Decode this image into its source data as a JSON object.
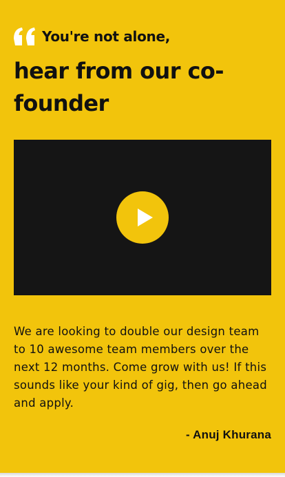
{
  "testimonial": {
    "subtitle": "You're not alone,",
    "heading": "hear from our co-founder",
    "quote_icon": "quote-icon",
    "video": {
      "play_icon": "play-icon",
      "accent_color": "#F2C40C",
      "background_color": "#151515"
    },
    "body": "We are looking to double our design team to 10 awesome team members over the next 12 months. Come grow with us! If this sounds like your kind of gig, then go ahead and apply.",
    "author": "- Anuj Khurana"
  },
  "colors": {
    "card_background": "#F2C40C",
    "text": "#111111",
    "quote_mark": "#ffffff"
  }
}
